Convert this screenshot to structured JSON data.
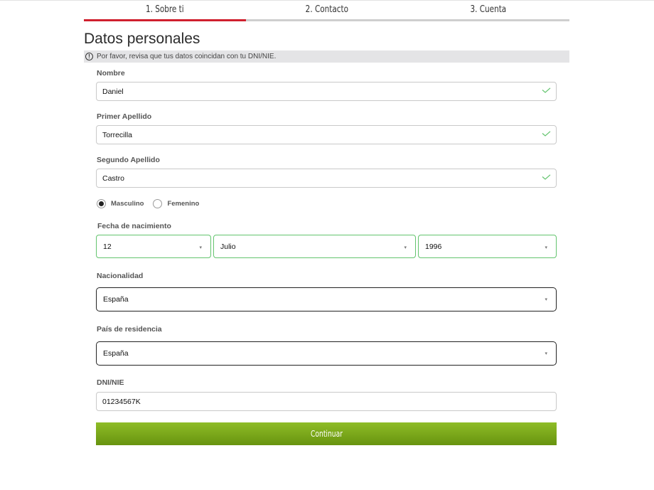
{
  "steps": [
    {
      "label": "1. Sobre ti",
      "active": true
    },
    {
      "label": "2. Contacto",
      "active": false
    },
    {
      "label": "3. Cuenta",
      "active": false
    }
  ],
  "section": {
    "title": "Datos personales",
    "notice": "Por favor, revisa que tus datos coincidan con tu DNI/NIE."
  },
  "fields": {
    "nombre": {
      "label": "Nombre",
      "value": "Daniel",
      "valid": true
    },
    "primer_apellido": {
      "label": "Primer Apellido",
      "value": "Torrecilla",
      "valid": true
    },
    "segundo_apellido": {
      "label": "Segundo Apellido",
      "value": "Castro",
      "valid": true
    },
    "dni": {
      "label": "DNI/NIE",
      "value": "01234567K"
    }
  },
  "gender": {
    "options": [
      {
        "label": "Masculino",
        "selected": true
      },
      {
        "label": "Femenino",
        "selected": false
      }
    ]
  },
  "birthdate": {
    "label": "Fecha de nacimiento",
    "day": "12",
    "month": "Julio",
    "year": "1996"
  },
  "nacionalidad": {
    "label": "Nacionalidad",
    "value": "España"
  },
  "residencia": {
    "label": "País de residencia",
    "value": "España"
  },
  "continue_label": "Continuar",
  "colors": {
    "active_step": "#d0202e",
    "valid": "#63c46e",
    "button": "#7aa81b"
  }
}
